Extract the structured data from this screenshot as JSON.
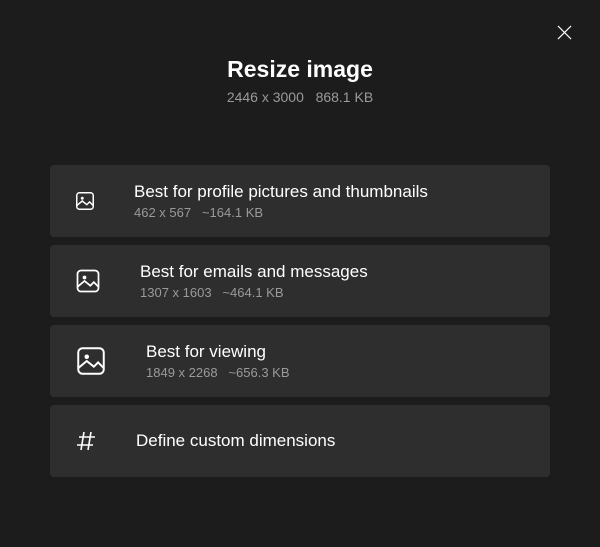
{
  "header": {
    "title": "Resize image",
    "dimensions": "2446 x 3000",
    "filesize": "868.1 KB"
  },
  "options": [
    {
      "title": "Best for profile pictures and thumbnails",
      "dimensions": "462 x 567",
      "filesize": "~164.1 KB"
    },
    {
      "title": "Best for emails and messages",
      "dimensions": "1307 x 1603",
      "filesize": "~464.1 KB"
    },
    {
      "title": "Best for viewing",
      "dimensions": "1849 x 2268",
      "filesize": "~656.3 KB"
    },
    {
      "title": "Define custom dimensions"
    }
  ]
}
